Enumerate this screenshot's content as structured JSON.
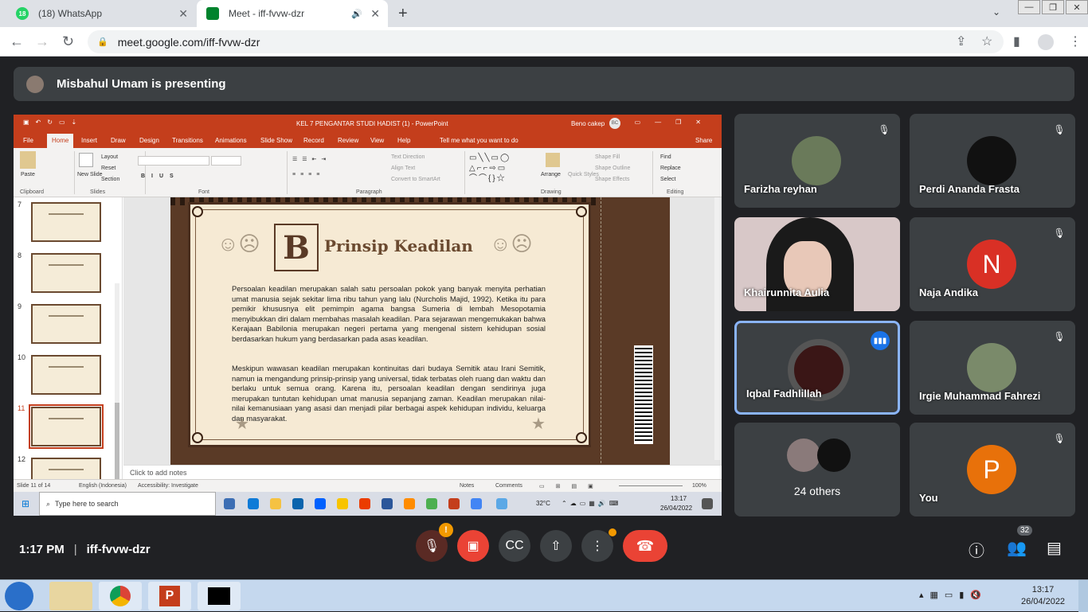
{
  "browser": {
    "tabs": [
      {
        "label": "(18) WhatsApp",
        "badge": "18"
      },
      {
        "label": "Meet - iff-fvvw-dzr"
      }
    ],
    "url": "meet.google.com/iff-fvvw-dzr"
  },
  "meet": {
    "presenting": "Misbahul Umam is presenting",
    "time": "1:17 PM",
    "code": "iff-fvvw-dzr",
    "people_count": "32",
    "participants": [
      {
        "name": "Farizha reyhan"
      },
      {
        "name": "Perdi Ananda Frasta"
      },
      {
        "name": "Khairunnita Aulia"
      },
      {
        "name": "Naja Andika",
        "initial": "N",
        "color": "#d93025"
      },
      {
        "name": "Iqbal Fadhlillah"
      },
      {
        "name": "Irgie Muhammad Fahrezi"
      },
      {
        "name": "24 others"
      },
      {
        "name": "You",
        "initial": "P",
        "color": "#e8710a"
      }
    ]
  },
  "ppt": {
    "title": "KEL 7 PENGANTAR STUDI HADIST (1)  -  PowerPoint",
    "user": "Beno cakep",
    "user_initials": "BC",
    "menu": [
      "File",
      "Home",
      "Insert",
      "Draw",
      "Design",
      "Transitions",
      "Animations",
      "Slide Show",
      "Record",
      "Review",
      "View",
      "Help",
      "Tell me what you want to do",
      "Share"
    ],
    "ribbon": {
      "paste": "Paste",
      "clipboard": "Clipboard",
      "new_slide": "New Slide",
      "slides": "Slides",
      "layout": "Layout",
      "reset": "Reset",
      "section": "Section",
      "font": "Font",
      "paragraph": "Paragraph",
      "text_direction": "Text Direction",
      "align_text": "Align Text",
      "smartart": "Convert to SmartArt",
      "drawing": "Drawing",
      "arrange": "Arrange",
      "quick_styles": "Quick Styles",
      "shape_fill": "Shape Fill",
      "shape_outline": "Shape Outline",
      "shape_effects": "Shape Effects",
      "find": "Find",
      "replace": "Replace",
      "select": "Select",
      "editing": "Editing"
    },
    "thumb_numbers": [
      "7",
      "8",
      "9",
      "10",
      "11",
      "12"
    ],
    "slide": {
      "letter": "B",
      "heading": "Prinsip Keadilan",
      "para1": "Persoalan keadilan merupakan salah satu persoalan pokok yang banyak menyita perhatian umat manusia sejak sekitar lima ribu tahun yang lalu (Nurcholis Majid, 1992). Ketika itu para pemikir khususnya elit pemimpin agama bangsa Sumeria di lembah Mesopotamia menyibukkan diri dalam membahas masalah keadilan. Para sejarawan mengemukakan bahwa Kerajaan Babilonia merupakan negeri pertama yang mengenal sistem kehidupan sosial berdasarkan hukum yang berdasarkan pada asas keadilan.",
      "para2": "Meskipun wawasan keadilan merupakan kontinuitas dari budaya Semitik atau Irani Semitik, namun ia mengandung prinsip-prinsip yang universal, tidak terbatas oleh ruang dan waktu dan berlaku untuk semua orang. Karena itu, persoalan keadilan dengan sendirinya juga merupakan tuntutan kehidupan umat manusia sepanjang zaman. Keadilan merupakan nilai-nilai kemanusiaan yang asasi dan menjadi pilar berbagai aspek kehidupan individu, keluarga dan masyarakat."
    },
    "notes": "Click to add notes",
    "status": {
      "slide": "Slide 11 of 14",
      "lang": "English (Indonesia)",
      "access": "Accessibility: Investigate",
      "notes": "Notes",
      "comments": "Comments",
      "zoom": "100%"
    }
  },
  "inner_taskbar": {
    "search": "Type here to search",
    "temp": "32°C",
    "time": "13:17",
    "date": "26/04/2022"
  },
  "taskbar": {
    "time": "13:17",
    "date": "26/04/2022"
  }
}
